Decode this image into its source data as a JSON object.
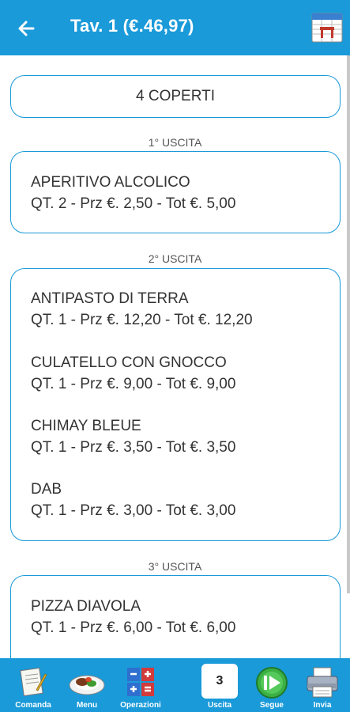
{
  "header": {
    "title": "Tav. 1 (€.46,97)",
    "back_icon": "arrow-left-icon",
    "table_icon": "table-icon"
  },
  "coperti": "4 COPERTI",
  "sections": [
    {
      "label": "1° USCITA",
      "items": [
        {
          "name": "APERITIVO ALCOLICO",
          "detail": "QT. 2 - Prz €. 2,50 - Tot €. 5,00"
        }
      ]
    },
    {
      "label": "2° USCITA",
      "items": [
        {
          "name": "ANTIPASTO DI TERRA",
          "detail": "QT. 1 - Prz €. 12,20 - Tot €. 12,20"
        },
        {
          "name": "CULATELLO CON GNOCCO",
          "detail": "QT. 1 - Prz €. 9,00 - Tot €. 9,00"
        },
        {
          "name": "CHIMAY BLEUE",
          "detail": "QT. 1 - Prz €. 3,50 - Tot €. 3,50"
        },
        {
          "name": "DAB",
          "detail": "QT. 1 - Prz €. 3,00 - Tot €. 3,00"
        }
      ]
    },
    {
      "label": "3° USCITA",
      "items": [
        {
          "name": "PIZZA DIAVOLA",
          "detail": "QT. 1 - Prz €. 6,00 - Tot €. 6,00"
        }
      ]
    }
  ],
  "toolbar": {
    "comanda": "Comanda",
    "menu": "Menu",
    "operazioni": "Operazioni",
    "uscita": "Uscita",
    "uscita_value": "3",
    "segue": "Segue",
    "invia": "Invia"
  },
  "colors": {
    "primary": "#1a9ad9",
    "card_border": "#1a9ad9",
    "segue_green": "#3cb043"
  }
}
